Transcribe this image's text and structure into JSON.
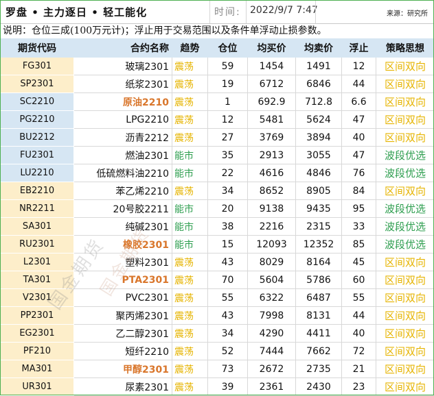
{
  "header": {
    "title": "罗盘 • 主力逐日 • 轻工能化",
    "time_label": "时间:",
    "time_value": "2022/9/7 7:47",
    "source": "来源：研究所"
  },
  "note": "说明：仓位三成(100万元计)；浮止用于交易范围以及条件单浮动止损参数。",
  "columns": [
    "期货代码",
    "合约名称",
    "趋势",
    "仓位",
    "均买价",
    "均卖价",
    "浮止",
    "策略思想"
  ],
  "rows": [
    {
      "code": "FG301",
      "name": "玻璃2301",
      "trend": "震荡",
      "position": "59",
      "avg_buy": "1454",
      "avg_sell": "1491",
      "stop": "12",
      "strategy": "区间双向"
    },
    {
      "code": "SP2301",
      "name": "纸浆2301",
      "trend": "震荡",
      "position": "19",
      "avg_buy": "6712",
      "avg_sell": "6846",
      "stop": "44",
      "strategy": "区间双向"
    },
    {
      "code": "SC2210",
      "name": "原油2210",
      "trend": "震荡",
      "position": "1",
      "avg_buy": "692.9",
      "avg_sell": "712.8",
      "stop": "6.6",
      "strategy": "区间双向"
    },
    {
      "code": "PG2210",
      "name": "LPG2210",
      "trend": "震荡",
      "position": "12",
      "avg_buy": "5481",
      "avg_sell": "5624",
      "stop": "47",
      "strategy": "区间双向"
    },
    {
      "code": "BU2212",
      "name": "沥青2212",
      "trend": "震荡",
      "position": "27",
      "avg_buy": "3769",
      "avg_sell": "3894",
      "stop": "40",
      "strategy": "区间双向"
    },
    {
      "code": "FU2301",
      "name": "燃油2301",
      "trend": "能市",
      "position": "35",
      "avg_buy": "2913",
      "avg_sell": "3055",
      "stop": "47",
      "strategy": "波段优选"
    },
    {
      "code": "LU2210",
      "name": "低硫燃料油2210",
      "trend": "能市",
      "position": "22",
      "avg_buy": "4616",
      "avg_sell": "4846",
      "stop": "76",
      "strategy": "波段优选"
    },
    {
      "code": "EB2210",
      "name": "苯乙烯2210",
      "trend": "震荡",
      "position": "34",
      "avg_buy": "8652",
      "avg_sell": "8905",
      "stop": "84",
      "strategy": "区间双向"
    },
    {
      "code": "NR2211",
      "name": "20号胶2211",
      "trend": "能市",
      "position": "20",
      "avg_buy": "9138",
      "avg_sell": "9435",
      "stop": "95",
      "strategy": "波段优选"
    },
    {
      "code": "SA301",
      "name": "纯碱2301",
      "trend": "能市",
      "position": "38",
      "avg_buy": "2216",
      "avg_sell": "2315",
      "stop": "33",
      "strategy": "波段优选"
    },
    {
      "code": "RU2301",
      "name": "橡胶2301",
      "trend": "能市",
      "position": "15",
      "avg_buy": "12093",
      "avg_sell": "12352",
      "stop": "85",
      "strategy": "波段优选"
    },
    {
      "code": "L2301",
      "name": "塑料2301",
      "trend": "震荡",
      "position": "43",
      "avg_buy": "8029",
      "avg_sell": "8164",
      "stop": "45",
      "strategy": "区间双向"
    },
    {
      "code": "TA301",
      "name": "PTA2301",
      "trend": "震荡",
      "position": "70",
      "avg_buy": "5604",
      "avg_sell": "5786",
      "stop": "60",
      "strategy": "区间双向"
    },
    {
      "code": "V2301",
      "name": "PVC2301",
      "trend": "震荡",
      "position": "55",
      "avg_buy": "6322",
      "avg_sell": "6487",
      "stop": "55",
      "strategy": "区间双向"
    },
    {
      "code": "PP2301",
      "name": "聚丙烯2301",
      "trend": "震荡",
      "position": "43",
      "avg_buy": "7998",
      "avg_sell": "8131",
      "stop": "44",
      "strategy": "区间双向"
    },
    {
      "code": "EG2301",
      "name": "乙二醇2301",
      "trend": "震荡",
      "position": "34",
      "avg_buy": "4290",
      "avg_sell": "4411",
      "stop": "40",
      "strategy": "区间双向"
    },
    {
      "code": "PF210",
      "name": "短纤2210",
      "trend": "震荡",
      "position": "52",
      "avg_buy": "7444",
      "avg_sell": "7662",
      "stop": "72",
      "strategy": "区间双向"
    },
    {
      "code": "MA301",
      "name": "甲醇2301",
      "trend": "震荡",
      "position": "73",
      "avg_buy": "2672",
      "avg_sell": "2735",
      "stop": "21",
      "strategy": "区间双向"
    },
    {
      "code": "UR301",
      "name": "尿素2301",
      "trend": "震荡",
      "position": "39",
      "avg_buy": "2361",
      "avg_sell": "2430",
      "stop": "23",
      "strategy": "区间双向"
    }
  ],
  "watermark": "国金期货",
  "colors": {
    "header_bg": "#d6e6f3",
    "code_yellow": "#fdeeca",
    "code_blue": "#d6e6f3",
    "oscillate": "#e6b400",
    "trend_green": "#2e9e4f",
    "highlight_name": "#d9762b"
  }
}
